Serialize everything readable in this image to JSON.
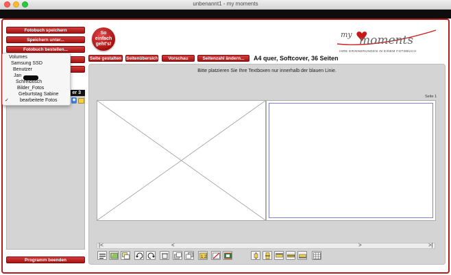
{
  "window": {
    "title": "unbenannt1 - my moments"
  },
  "left_buttons": {
    "save_book": "Fotobuch speichern",
    "save_as": "Speichern unter...",
    "order": "Fotobuch bestellen...",
    "quit": "Programm beenden"
  },
  "badge": {
    "line1": "So",
    "line2": "einfach",
    "line3": "geht's!"
  },
  "tabs": [
    {
      "label": "Seite gestalten"
    },
    {
      "label": "Seitenübersicht"
    },
    {
      "label": "Vorschau"
    },
    {
      "label": "Seitenzahl ändern..."
    }
  ],
  "book_info": "A4 quer, Softcover, 36 Seiten",
  "logo": {
    "my": "my",
    "moments": "moments",
    "tagline": "IHRE ERINNERUNGEN IN EINEM FOTOBUCH"
  },
  "panel": {
    "header_fragment": "er 3"
  },
  "dropdown": {
    "items": [
      {
        "label": "Volumes",
        "checked": false
      },
      {
        "label": "Samsung SSD",
        "checked": false
      },
      {
        "label": "Benutzer",
        "checked": false
      },
      {
        "label": "Jan",
        "checked": false
      },
      {
        "label": "Schreibtisch",
        "checked": false
      },
      {
        "label": "Bilder_Fotos",
        "checked": false
      },
      {
        "label": "Geburtstag Sabine",
        "checked": false
      },
      {
        "label": "bearbeitete Fotos",
        "checked": true
      }
    ],
    "check_glyph": "✓"
  },
  "editor": {
    "hint": "Bitte platzieren Sie Ihre Textboxen nur innerhalb der blauen Linie.",
    "page_label": "Seite 1"
  },
  "scroll": {
    "first": "|<",
    "prev": "<",
    "next": ">",
    "last": ">|"
  },
  "colors": {
    "accent_red": "#b31a1a",
    "panel_gray": "#d4d4d4"
  }
}
